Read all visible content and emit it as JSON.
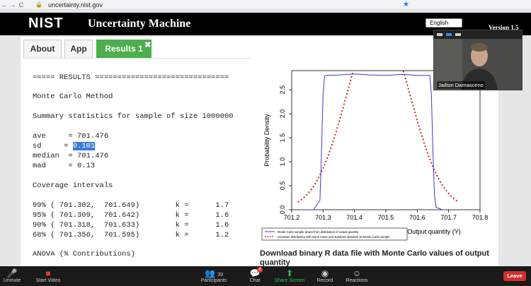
{
  "browser": {
    "url": "uncertainty.nist.gov",
    "back_icon": "←",
    "forward_icon": "→",
    "reload_icon": "C"
  },
  "header": {
    "logo": "NIST",
    "title": "Uncertainty Machine",
    "version": "Version 1.5",
    "language": "English"
  },
  "tabs": [
    {
      "label": "About"
    },
    {
      "label": "App"
    },
    {
      "label": "Results 1"
    }
  ],
  "results": {
    "lines": [
      "===== RESULTS ==============================",
      "Monte Carlo Method",
      "Summary statistics for sample of size 1000000",
      "ave     = 701.476",
      "sd     = ",
      "0.101",
      "median  = 701.476",
      "mad     = 0.13",
      "Coverage intervals",
      "99% ( 701.302,  701.649)        k =      1.7",
      "95% ( 701.309,  701.642)        k =      1.6",
      "90% ( 701.318,  701.633)        k =      1.6",
      "68% ( 701.356,  701.595)        k =      1.2",
      "ANOVA (% Contributions)"
    ]
  },
  "chart_data": {
    "type": "line",
    "xlabel": "Output quantity (Y)",
    "ylabel": "Probability Density",
    "xlim": [
      701.2,
      701.8
    ],
    "ylim": [
      0,
      2.9
    ],
    "x_ticks": [
      "701.2",
      "701.3",
      "701.4",
      "701.5",
      "701.6",
      "701.7",
      "701.8"
    ],
    "y_ticks": [
      "0.0",
      "0.5",
      "1.0",
      "1.5",
      "2.0",
      "2.5"
    ],
    "series": [
      {
        "name": "Monte Carlo sample drawn from distribution of output quantity",
        "color": "#3b3bc8",
        "style": "solid",
        "x": [
          701.24,
          701.27,
          701.29,
          701.295,
          701.3,
          701.305,
          701.31,
          701.35,
          701.4,
          701.45,
          701.5,
          701.55,
          701.6,
          701.64,
          701.645,
          701.65,
          701.655,
          701.66,
          701.68,
          701.7
        ],
        "y": [
          0.0,
          0.0,
          0.2,
          1.2,
          2.4,
          2.79,
          2.8,
          2.81,
          2.83,
          2.81,
          2.8,
          2.82,
          2.8,
          2.8,
          2.4,
          1.2,
          0.3,
          0.05,
          0.0,
          0.0
        ]
      },
      {
        "name": "Gaussian distribution with same mean and standard deviation as Monte Carlo sample",
        "color": "#cc1111",
        "style": "dotted",
        "x": [
          701.22,
          701.26,
          701.3,
          701.33,
          701.36,
          701.4,
          701.43,
          701.476,
          701.52,
          701.55,
          701.59,
          701.62,
          701.65,
          701.69,
          701.73
        ],
        "y": [
          0.03,
          0.19,
          0.67,
          1.4,
          2.2,
          3.0,
          3.5,
          3.95,
          3.5,
          3.0,
          2.2,
          1.4,
          0.67,
          0.19,
          0.03
        ]
      }
    ],
    "legend": "bottom-left"
  },
  "download": {
    "title": "Download binary R data file with Monte Carlo values of output quantity"
  },
  "video": {
    "participant_name": "Jailton Damasceno"
  },
  "zoom_toolbar": {
    "unmute": "Unmute",
    "start_video": "Start Video",
    "participants": "Participants",
    "participants_count": "39",
    "chat": "Chat",
    "chat_badge": "4",
    "share_screen": "Share Screen",
    "record": "Record",
    "reactions": "Reactions",
    "leave": "Leave"
  }
}
